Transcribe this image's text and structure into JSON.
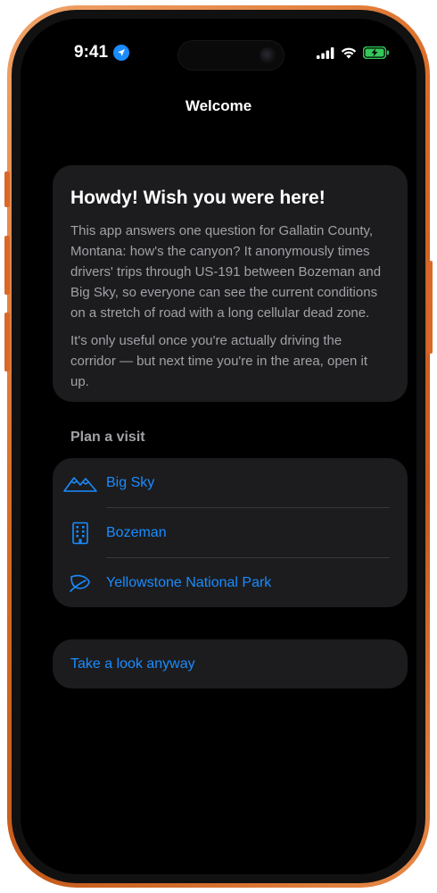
{
  "status_bar": {
    "time": "9:41",
    "location_icon": "location-arrow-icon",
    "signal_icon": "cellular-signal-icon",
    "wifi_icon": "wifi-icon",
    "battery_icon": "battery-charging-icon",
    "battery_color": "#34c759"
  },
  "nav": {
    "title": "Welcome"
  },
  "intro": {
    "title": "Howdy! Wish you were here!",
    "paragraph_1": "This app answers one question for Gallatin County, Montana: how's the canyon? It anonymously times drivers' trips through US-191 between Bozeman and Big Sky, so everyone can see the current conditions on a stretch of road with a long cellular dead zone.",
    "paragraph_2": "It's only useful once you're actually driving the corridor — but next time you're in the area, open it up."
  },
  "plan": {
    "header": "Plan a visit",
    "items": [
      {
        "label": "Big Sky",
        "icon": "mountains-icon"
      },
      {
        "label": "Bozeman",
        "icon": "building-icon"
      },
      {
        "label": "Yellowstone National Park",
        "icon": "leaf-icon"
      }
    ]
  },
  "actions": {
    "take_a_look": "Take a look anyway"
  },
  "colors": {
    "accent": "#1a8cff",
    "card_bg": "#1c1c1e",
    "secondary_text": "#a1a1a6",
    "device_frame": "#d96a24"
  }
}
